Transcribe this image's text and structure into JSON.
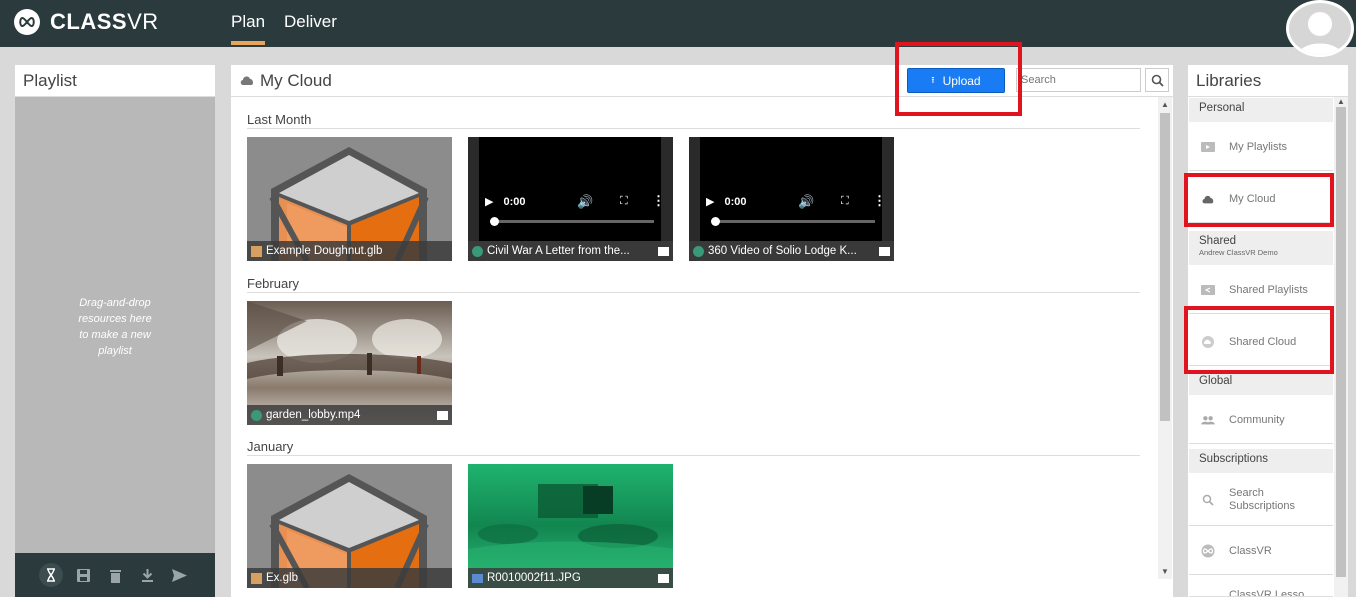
{
  "app": {
    "brand_bold": "CLASS",
    "brand_light": "VR"
  },
  "nav": {
    "tabs": [
      {
        "label": "Plan"
      },
      {
        "label": "Deliver"
      }
    ]
  },
  "playlist": {
    "title": "Playlist",
    "dropzone": [
      "Drag-and-drop",
      "resources here",
      "to make a new",
      "playlist"
    ]
  },
  "cloud": {
    "title": "My Cloud",
    "upload_label": "Upload",
    "search_placeholder": "Search",
    "sections": [
      {
        "label": "Last Month"
      },
      {
        "label": "February"
      },
      {
        "label": "January"
      }
    ],
    "items": [
      {
        "name": "Example Doughnut.glb",
        "type": "model"
      },
      {
        "name": "Civil War A Letter from the...",
        "type": "video",
        "time": "0:00"
      },
      {
        "name": "360 Video of Solio Lodge K...",
        "type": "video",
        "time": "0:00"
      },
      {
        "name": "garden_lobby.mp4",
        "type": "image"
      },
      {
        "name": "Ex.glb",
        "type": "model"
      },
      {
        "name": "R0010002f11.JPG",
        "type": "image"
      }
    ]
  },
  "libraries": {
    "title": "Libraries",
    "sections": {
      "personal": "Personal",
      "shared": "Shared",
      "shared_owner": "Andrew ClassVR Demo",
      "global": "Global",
      "subscriptions": "Subscriptions"
    },
    "items": {
      "my_playlists": "My Playlists",
      "my_cloud": "My Cloud",
      "shared_playlists": "Shared Playlists",
      "shared_cloud": "Shared Cloud",
      "community": "Community",
      "search_subscriptions_1": "Search",
      "search_subscriptions_2": "Subscriptions",
      "classvr": "ClassVR",
      "classvr_lessons": "ClassVR Lesso..."
    }
  },
  "colors": {
    "topbar": "#2a3a3d",
    "accent": "#e8a45a",
    "upload": "#1a7cf5",
    "highlight": "#e0141e"
  }
}
